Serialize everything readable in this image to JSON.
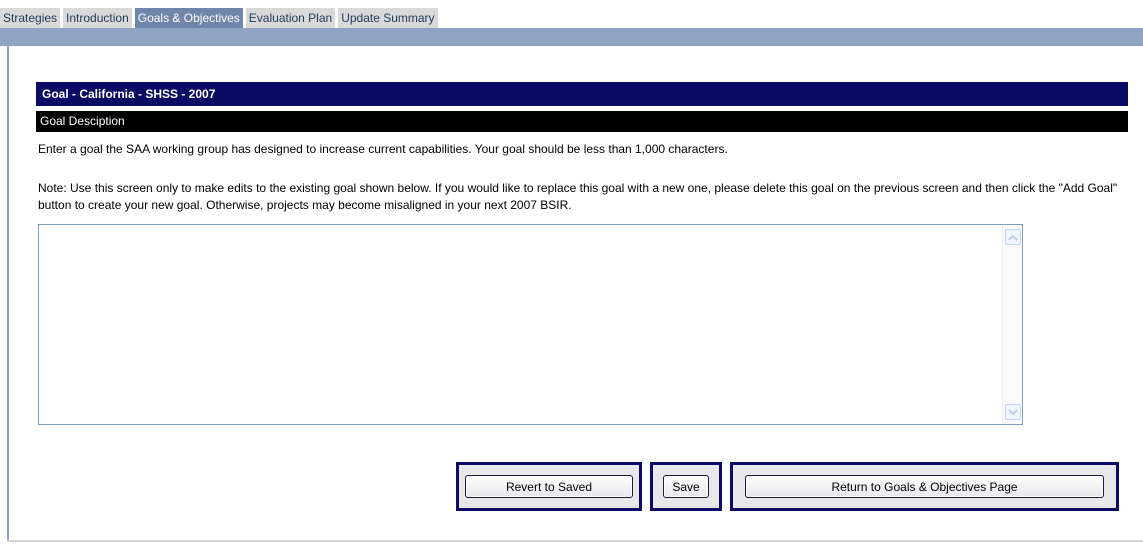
{
  "tabs": [
    {
      "label": "Strategies",
      "active": false
    },
    {
      "label": "Introduction",
      "active": false
    },
    {
      "label": "Goals & Objectives",
      "active": true
    },
    {
      "label": "Evaluation Plan",
      "active": false
    },
    {
      "label": "Update Summary",
      "active": false
    }
  ],
  "goal": {
    "header": "Goal - California - SHSS - 2007",
    "section_label": "Goal Desciption",
    "instructions": "Enter a goal the SAA working group has designed to increase current capabilities. Your goal should be less than 1,000 characters.",
    "note": "Note: Use this screen only to make edits to the existing goal shown below. If you would like to replace this goal with a new one, please delete this goal on the previous screen and then click the \"Add Goal\" button to create your new goal. Otherwise, projects may become misaligned in your next 2007 BSIR.",
    "description_value": ""
  },
  "buttons": {
    "revert": "Revert to Saved",
    "save": "Save",
    "return": "Return to Goals & Objectives Page"
  },
  "icons": {
    "scroll_up": "chevron-up-icon",
    "scroll_down": "chevron-down-icon"
  },
  "colors": {
    "active_tab": "#6f86aa",
    "inactive_tab": "#d9d9d9",
    "band": "#8fa3c2",
    "header_navy": "#0b0b63",
    "section_black": "#000000"
  }
}
